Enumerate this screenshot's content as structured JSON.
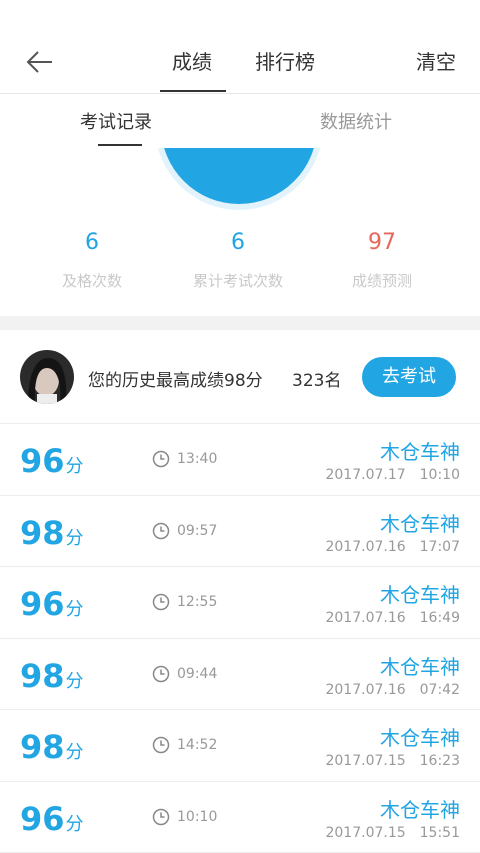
{
  "nav": {
    "tabs": [
      "成绩",
      "排行榜"
    ],
    "clear_label": "清空"
  },
  "subtabs": [
    "考试记录",
    "数据统计"
  ],
  "summary": {
    "stats": [
      {
        "value": "6",
        "label": "及格次数",
        "color": "#22a5e3"
      },
      {
        "value": "6",
        "label": "累计考试次数",
        "color": "#22a5e3"
      },
      {
        "value": "97",
        "label": "成绩预测",
        "color": "#e8665a"
      }
    ]
  },
  "history": {
    "best_text": "您的历史最高成绩98分",
    "rank_text": "323名",
    "exam_button": "去考试"
  },
  "records": [
    {
      "score": "96",
      "unit": "分",
      "duration": "13:40",
      "name": "木仓车神",
      "date": "2017.07.17　10:10"
    },
    {
      "score": "98",
      "unit": "分",
      "duration": "09:57",
      "name": "木仓车神",
      "date": "2017.07.16　17:07"
    },
    {
      "score": "96",
      "unit": "分",
      "duration": "12:55",
      "name": "木仓车神",
      "date": "2017.07.16　16:49"
    },
    {
      "score": "98",
      "unit": "分",
      "duration": "09:44",
      "name": "木仓车神",
      "date": "2017.07.16　07:42"
    },
    {
      "score": "98",
      "unit": "分",
      "duration": "14:52",
      "name": "木仓车神",
      "date": "2017.07.15　16:23"
    },
    {
      "score": "96",
      "unit": "分",
      "duration": "10:10",
      "name": "木仓车神",
      "date": "2017.07.15　15:51"
    }
  ],
  "colors": {
    "accent": "#22a5e3",
    "prediction": "#e8665a"
  }
}
